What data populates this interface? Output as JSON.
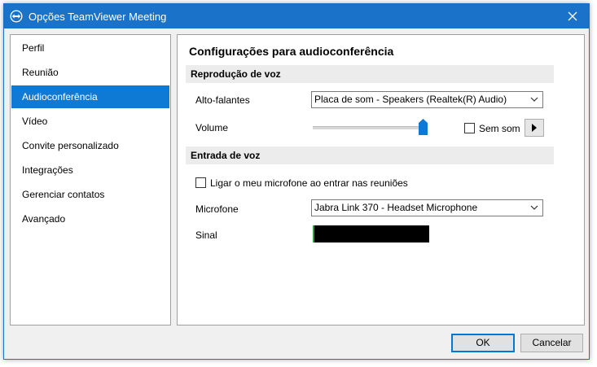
{
  "window": {
    "title": "Opções TeamViewer Meeting",
    "accent_color": "#1a73c8",
    "app_icon": "teamviewer-icon",
    "close_icon": "close-icon"
  },
  "sidebar": {
    "selected_color": "#0f7ad6",
    "items": [
      {
        "label": "Perfil"
      },
      {
        "label": "Reunião"
      },
      {
        "label": "Audioconferência",
        "selected": true
      },
      {
        "label": "Vídeo"
      },
      {
        "label": "Convite personalizado"
      },
      {
        "label": "Integrações"
      },
      {
        "label": "Gerenciar contatos"
      },
      {
        "label": "Avançado"
      }
    ]
  },
  "main": {
    "title": "Configurações para audioconferência",
    "voice_playback": {
      "header": "Reprodução de voz",
      "speakers_label": "Alto-falantes",
      "speakers_value": "Placa de som - Speakers (Realtek(R) Audio)",
      "volume_label": "Volume",
      "volume_level": 1.0,
      "mute_label": "Sem som",
      "mute_checked": false,
      "play_icon": "play-icon"
    },
    "voice_input": {
      "header": "Entrada de voz",
      "auto_mic_label": "Ligar o meu microfone ao entrar nas reuniões",
      "auto_mic_checked": false,
      "mic_label": "Microfone",
      "mic_value": "Jabra Link 370 - Headset Microphone",
      "signal_label": "Sinal",
      "signal_level": 0.01
    }
  },
  "footer": {
    "ok_label": "OK",
    "cancel_label": "Cancelar"
  }
}
